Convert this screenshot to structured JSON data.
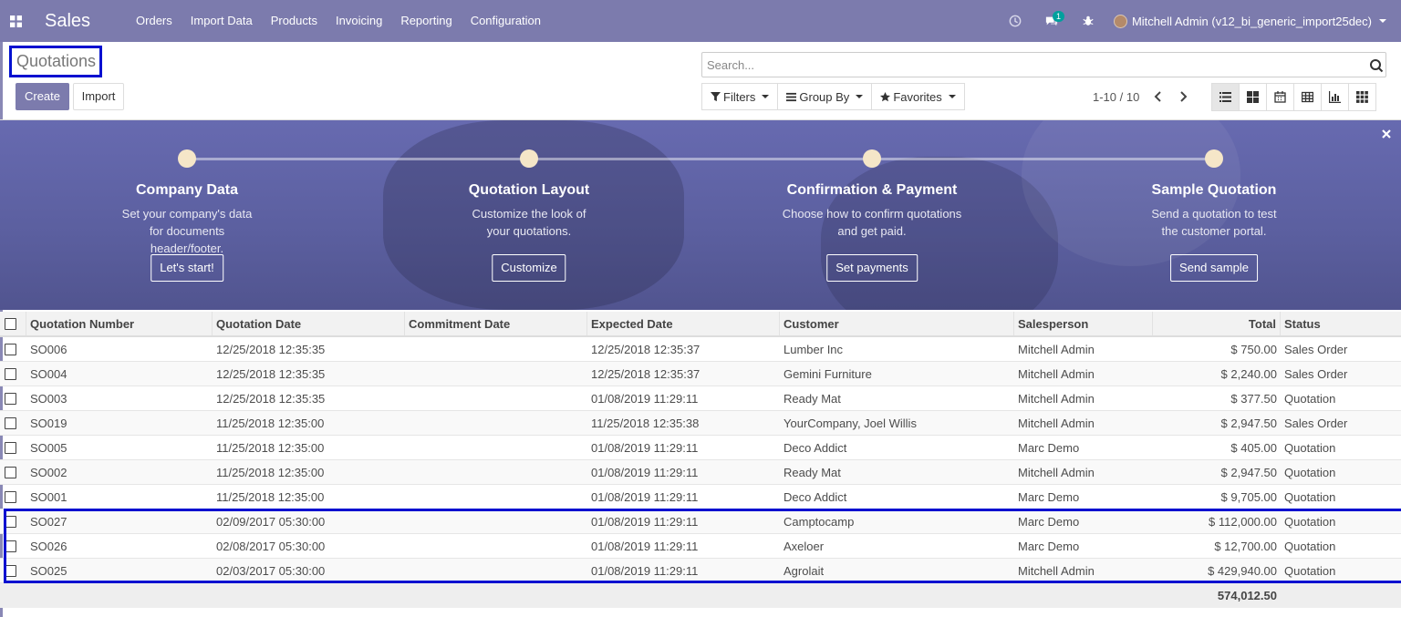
{
  "navbar": {
    "app_name": "Sales",
    "menu": [
      "Orders",
      "Import Data",
      "Products",
      "Invoicing",
      "Reporting",
      "Configuration"
    ],
    "chat_badge": "1",
    "user": "Mitchell Admin (v12_bi_generic_import25dec)"
  },
  "control_panel": {
    "breadcrumb": "Quotations",
    "create_label": "Create",
    "import_label": "Import",
    "search_placeholder": "Search...",
    "filters_label": "Filters",
    "groupby_label": "Group By",
    "favorites_label": "Favorites",
    "pager": "1-10 / 10"
  },
  "banner": {
    "steps": [
      {
        "title": "Company Data",
        "desc": "Set your company's data for documents header/footer.",
        "button": "Let's start!"
      },
      {
        "title": "Quotation Layout",
        "desc": "Customize the look of your quotations.",
        "button": "Customize"
      },
      {
        "title": "Confirmation & Payment",
        "desc": "Choose how to confirm quotations and get paid.",
        "button": "Set payments"
      },
      {
        "title": "Sample Quotation",
        "desc": "Send a quotation to test the customer portal.",
        "button": "Send sample"
      }
    ]
  },
  "table": {
    "columns": [
      "Quotation Number",
      "Quotation Date",
      "Commitment Date",
      "Expected Date",
      "Customer",
      "Salesperson",
      "Total",
      "Status"
    ],
    "rows": [
      [
        "SO006",
        "12/25/2018 12:35:35",
        "",
        "12/25/2018 12:35:37",
        "Lumber Inc",
        "Mitchell Admin",
        "$ 750.00",
        "Sales Order"
      ],
      [
        "SO004",
        "12/25/2018 12:35:35",
        "",
        "12/25/2018 12:35:37",
        "Gemini Furniture",
        "Mitchell Admin",
        "$ 2,240.00",
        "Sales Order"
      ],
      [
        "SO003",
        "12/25/2018 12:35:35",
        "",
        "01/08/2019 11:29:11",
        "Ready Mat",
        "Mitchell Admin",
        "$ 377.50",
        "Quotation"
      ],
      [
        "SO019",
        "11/25/2018 12:35:00",
        "",
        "11/25/2018 12:35:38",
        "YourCompany, Joel Willis",
        "Mitchell Admin",
        "$ 2,947.50",
        "Sales Order"
      ],
      [
        "SO005",
        "11/25/2018 12:35:00",
        "",
        "01/08/2019 11:29:11",
        "Deco Addict",
        "Marc Demo",
        "$ 405.00",
        "Quotation"
      ],
      [
        "SO002",
        "11/25/2018 12:35:00",
        "",
        "01/08/2019 11:29:11",
        "Ready Mat",
        "Mitchell Admin",
        "$ 2,947.50",
        "Quotation"
      ],
      [
        "SO001",
        "11/25/2018 12:35:00",
        "",
        "01/08/2019 11:29:11",
        "Deco Addict",
        "Marc Demo",
        "$ 9,705.00",
        "Quotation"
      ],
      [
        "SO027",
        "02/09/2017 05:30:00",
        "",
        "01/08/2019 11:29:11",
        "Camptocamp",
        "Marc Demo",
        "$ 112,000.00",
        "Quotation"
      ],
      [
        "SO026",
        "02/08/2017 05:30:00",
        "",
        "01/08/2019 11:29:11",
        "Axeloer",
        "Marc Demo",
        "$ 12,700.00",
        "Quotation"
      ],
      [
        "SO025",
        "02/03/2017 05:30:00",
        "",
        "01/08/2019 11:29:11",
        "Agrolait",
        "Mitchell Admin",
        "$ 429,940.00",
        "Quotation"
      ]
    ],
    "total": "574,012.50"
  },
  "colors": {
    "brand": "#7c7bad",
    "highlight": "#0010d0"
  }
}
